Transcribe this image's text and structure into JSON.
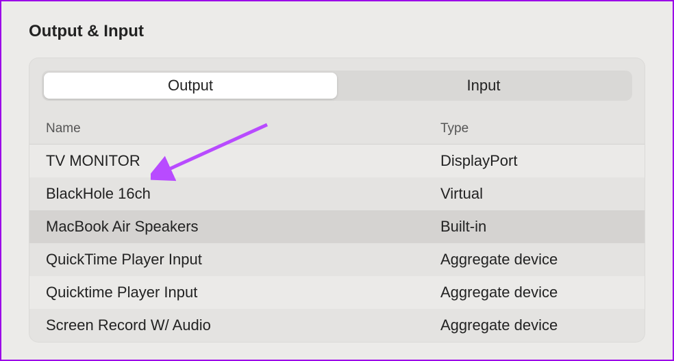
{
  "title": "Output & Input",
  "tabs": {
    "output": "Output",
    "input": "Input"
  },
  "columns": {
    "name": "Name",
    "type": "Type"
  },
  "rows": [
    {
      "name": "TV MONITOR",
      "type": "DisplayPort"
    },
    {
      "name": "BlackHole 16ch",
      "type": "Virtual"
    },
    {
      "name": "MacBook Air Speakers",
      "type": "Built-in"
    },
    {
      "name": "QuickTime Player Input",
      "type": "Aggregate device"
    },
    {
      "name": "Quicktime Player Input",
      "type": "Aggregate device"
    },
    {
      "name": "Screen Record W/ Audio",
      "type": "Aggregate device"
    }
  ],
  "selected_index": 2,
  "annotation": {
    "color": "#b84bff"
  }
}
